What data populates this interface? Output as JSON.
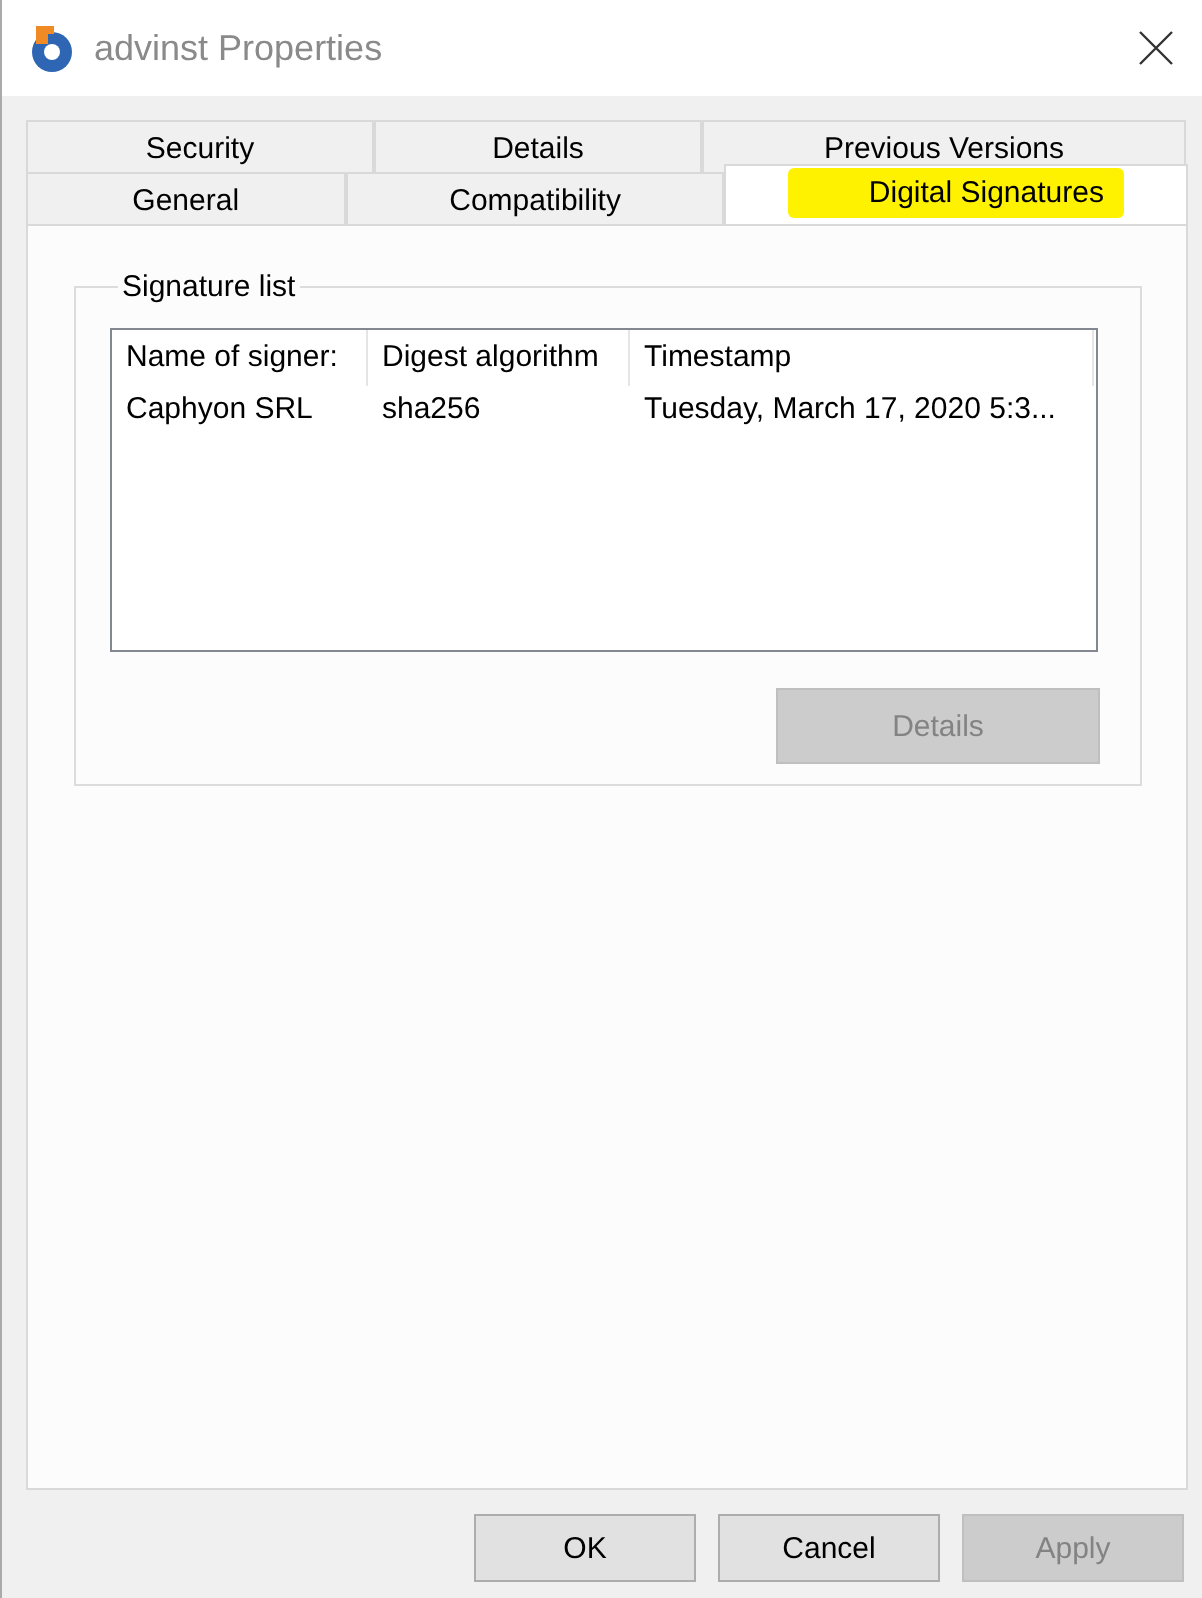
{
  "window": {
    "title": "advinst Properties"
  },
  "tab_rows": [
    {
      "tabs": [
        {
          "label": "Security",
          "selected": false,
          "highlighted": false
        },
        {
          "label": "Details",
          "selected": false,
          "highlighted": false
        },
        {
          "label": "Previous Versions",
          "selected": false,
          "highlighted": false
        }
      ]
    },
    {
      "tabs": [
        {
          "label": "General",
          "selected": false,
          "highlighted": false
        },
        {
          "label": "Compatibility",
          "selected": false,
          "highlighted": false
        },
        {
          "label": "Digital Signatures",
          "selected": true,
          "highlighted": true
        }
      ]
    }
  ],
  "signature_list": {
    "title": "Signature list",
    "columns": [
      "Name of signer:",
      "Digest algorithm",
      "Timestamp"
    ],
    "rows": [
      [
        "Caphyon SRL",
        "sha256",
        "Tuesday, March 17, 2020 5:3..."
      ]
    ],
    "details_button": {
      "label": "Details",
      "disabled": true
    }
  },
  "buttons": [
    {
      "label": "OK",
      "disabled": false
    },
    {
      "label": "Cancel",
      "disabled": false
    },
    {
      "label": "Apply",
      "disabled": true
    }
  ]
}
